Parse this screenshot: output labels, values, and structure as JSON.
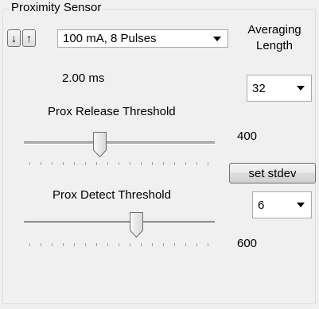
{
  "proximity": {
    "group_title": "Proximity Sensor",
    "down_arrow": "↓",
    "up_arrow": "↑",
    "led_setting": "100 mA, 8 Pulses",
    "timing_label": "2.00 ms",
    "averaging_label_line1": "Averaging",
    "averaging_label_line2": "Length",
    "averaging_value": "32",
    "release_label": "Prox Release Threshold",
    "release_value": "400",
    "set_stdev_label": "set stdev",
    "stdev_value": "6",
    "detect_label": "Prox Detect Threshold",
    "detect_value": "600",
    "release_slider_fraction": 0.4,
    "detect_slider_fraction": 0.6
  },
  "icons": {
    "down": "down-arrow-icon",
    "up": "up-arrow-icon",
    "dropdown": "chevron-down-icon"
  },
  "colors": {
    "window_bg": "#f0f0f0",
    "group_border": "#d5dfe5",
    "track": "#b0b0b0"
  }
}
